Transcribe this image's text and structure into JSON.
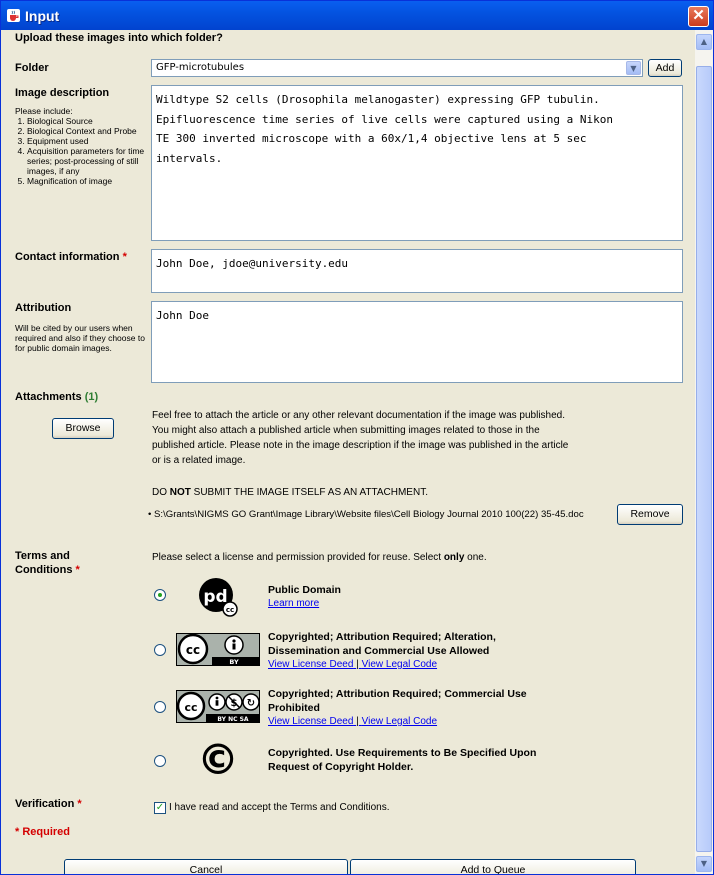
{
  "window": {
    "title": "Input",
    "close_glyph": "✕"
  },
  "header": {
    "prompt": "Upload these images into which folder?"
  },
  "folder": {
    "label": "Folder",
    "value": "GFP-microtubules",
    "add_label": "Add"
  },
  "description": {
    "label": "Image description",
    "hint_intro": "Please include:",
    "hint_items": [
      "Biological Source",
      "Biological Context and Probe",
      "Equipment used",
      "Acquisition parameters for time series; post-processing of still images, if any",
      "Magnification of image"
    ],
    "value": "Wildtype S2 cells (Drosophila melanogaster) expressing GFP tubulin.\nEpifluorescence time series of live cells were captured using a Nikon\nTE 300 inverted microscope with a 60x/1,4 objective lens at 5 sec\nintervals."
  },
  "contact": {
    "label": "Contact information",
    "required_mark": "*",
    "value": "John Doe, jdoe@university.edu"
  },
  "attribution": {
    "label": "Attribution",
    "hint": "Will be cited by our users when required and also if they choose to for public domain images.",
    "value": "John Doe"
  },
  "attachments": {
    "label": "Attachments",
    "count": "(1)",
    "browse_label": "Browse",
    "info": "Feel free to attach the article or any other relevant documentation if the image was published. You might also attach a published article when submitting images related to those in the published article. Please note in the image description if the image was published in the article or is a related image.",
    "warn_pre": "DO ",
    "warn_bold": "NOT",
    "warn_post": " SUBMIT THE IMAGE ITSELF AS AN ATTACHMENT.",
    "file": "• S:\\Grants\\NIGMS GO Grant\\Image Library\\Website files\\Cell Biology Journal 2010 100(22) 35-45.doc",
    "remove_label": "Remove"
  },
  "terms": {
    "label_line1": "Terms and",
    "label_line2": "Conditions",
    "required_mark": "*",
    "instr_pre": "Please select a license and permission provided for reuse. Select ",
    "instr_bold": "only",
    "instr_post": " one.",
    "options": [
      {
        "title": "Public Domain",
        "link1": "Learn more",
        "selected": true,
        "icon": "public-domain-icon",
        "logo_text": "pd",
        "logo_sub": "cc"
      },
      {
        "title": "Copyrighted; Attribution Required; Alteration, Dissemination and Commercial Use Allowed",
        "link1": "View License Deed",
        "sep": "|",
        "link2": "View Legal Code",
        "selected": false,
        "icon": "cc-by-icon",
        "badge_text": "BY"
      },
      {
        "title": "Copyrighted; Attribution Required; Commercial Use Prohibited",
        "link1": "View License Deed",
        "sep": "|",
        "link2": "View Legal Code",
        "selected": false,
        "icon": "cc-by-nc-sa-icon",
        "badge_text": "BY  NC  SA"
      },
      {
        "title": "Copyrighted. Use Requirements to Be Specified Upon Request of Copyright Holder.",
        "selected": false,
        "icon": "copyright-icon",
        "logo_text": "©"
      }
    ]
  },
  "verification": {
    "label": "Verification",
    "required_mark": "*",
    "checkbox_label": "I have read and accept the Terms and Conditions.",
    "checked": true
  },
  "footer": {
    "required_note": "* Required",
    "cancel_label": "Cancel",
    "queue_label": "Add to Queue"
  },
  "colors": {
    "title_bar": "#0453e0",
    "window_bg": "#ece9d8",
    "required": "#d40000",
    "count": "#2e7d32",
    "link": "#0000ee"
  }
}
